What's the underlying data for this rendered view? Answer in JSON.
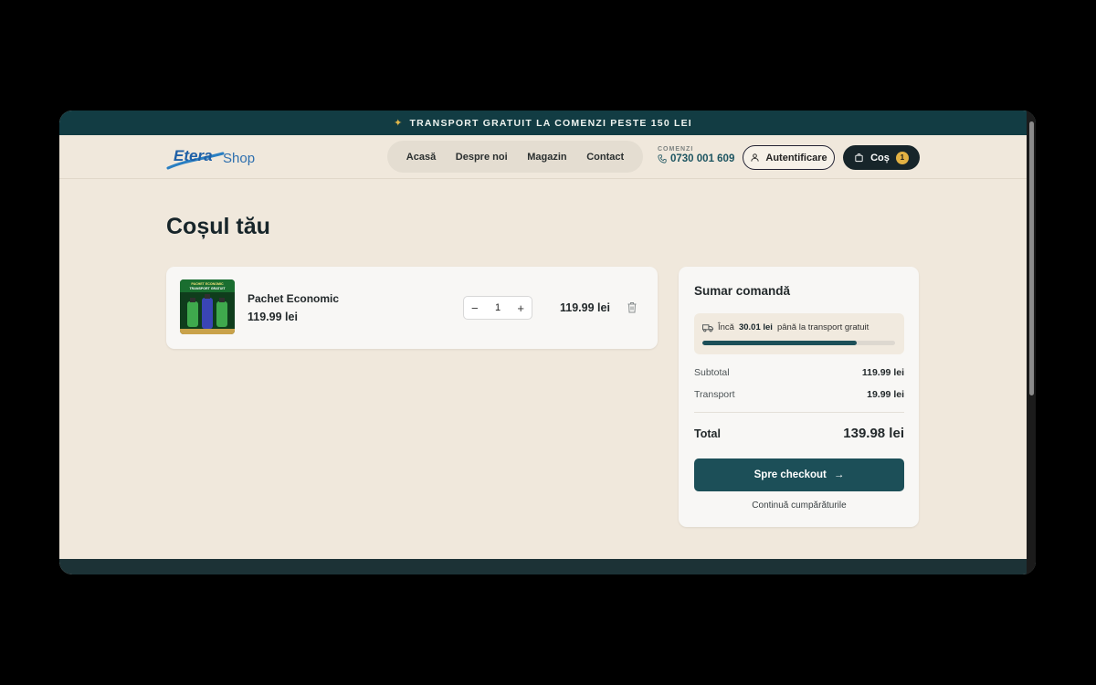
{
  "promo": {
    "icon": "sparkle-icon",
    "text": "TRANSPORT GRATUIT LA COMENZI PESTE 150 LEI"
  },
  "logo": {
    "brand": "Etera",
    "suffix": "Shop"
  },
  "nav": {
    "items": [
      "Acasă",
      "Despre noi",
      "Magazin",
      "Contact"
    ]
  },
  "contact": {
    "label": "COMENZI",
    "phone": "0730 001 609"
  },
  "auth": {
    "label": "Autentificare"
  },
  "cart": {
    "label": "Coș",
    "count": "1"
  },
  "page": {
    "title": "Coșul tău"
  },
  "item": {
    "name": "Pachet Economic",
    "price": "119.99 lei",
    "quantity": "1",
    "line_total": "119.99 lei",
    "image_caption": "PACHET ECONOMIC TRANSPORT GRATUIT"
  },
  "summary": {
    "title": "Sumar comandă",
    "shipping_prefix": "Încă",
    "shipping_amount": "30.01 lei",
    "shipping_suffix": "până la transport gratuit",
    "shipping_progress": 0.8,
    "subtotal_label": "Subtotal",
    "subtotal_value": "119.99 lei",
    "transport_label": "Transport",
    "transport_value": "19.99 lei",
    "total_label": "Total",
    "total_value": "139.98 lei",
    "checkout_label": "Spre checkout",
    "continue_label": "Continuă cumpărăturile"
  },
  "colors": {
    "accent": "#1c4f58",
    "promo_bg": "#123c43",
    "page_bg": "#f0e8dc",
    "badge": "#e2b143"
  }
}
